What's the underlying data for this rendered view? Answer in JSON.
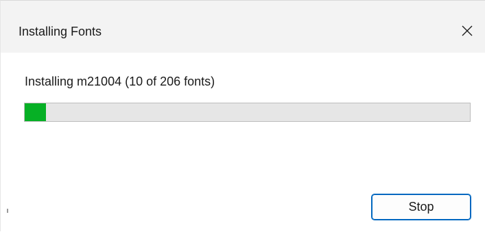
{
  "dialog": {
    "title": "Installing Fonts",
    "status_text": "Installing m21004 (10 of 206 fonts)",
    "progress": {
      "current": 10,
      "total": 206,
      "fill_color": "#06b025"
    },
    "stop_label": "Stop",
    "close_icon": "close-icon",
    "accent_color": "#0067c0"
  }
}
